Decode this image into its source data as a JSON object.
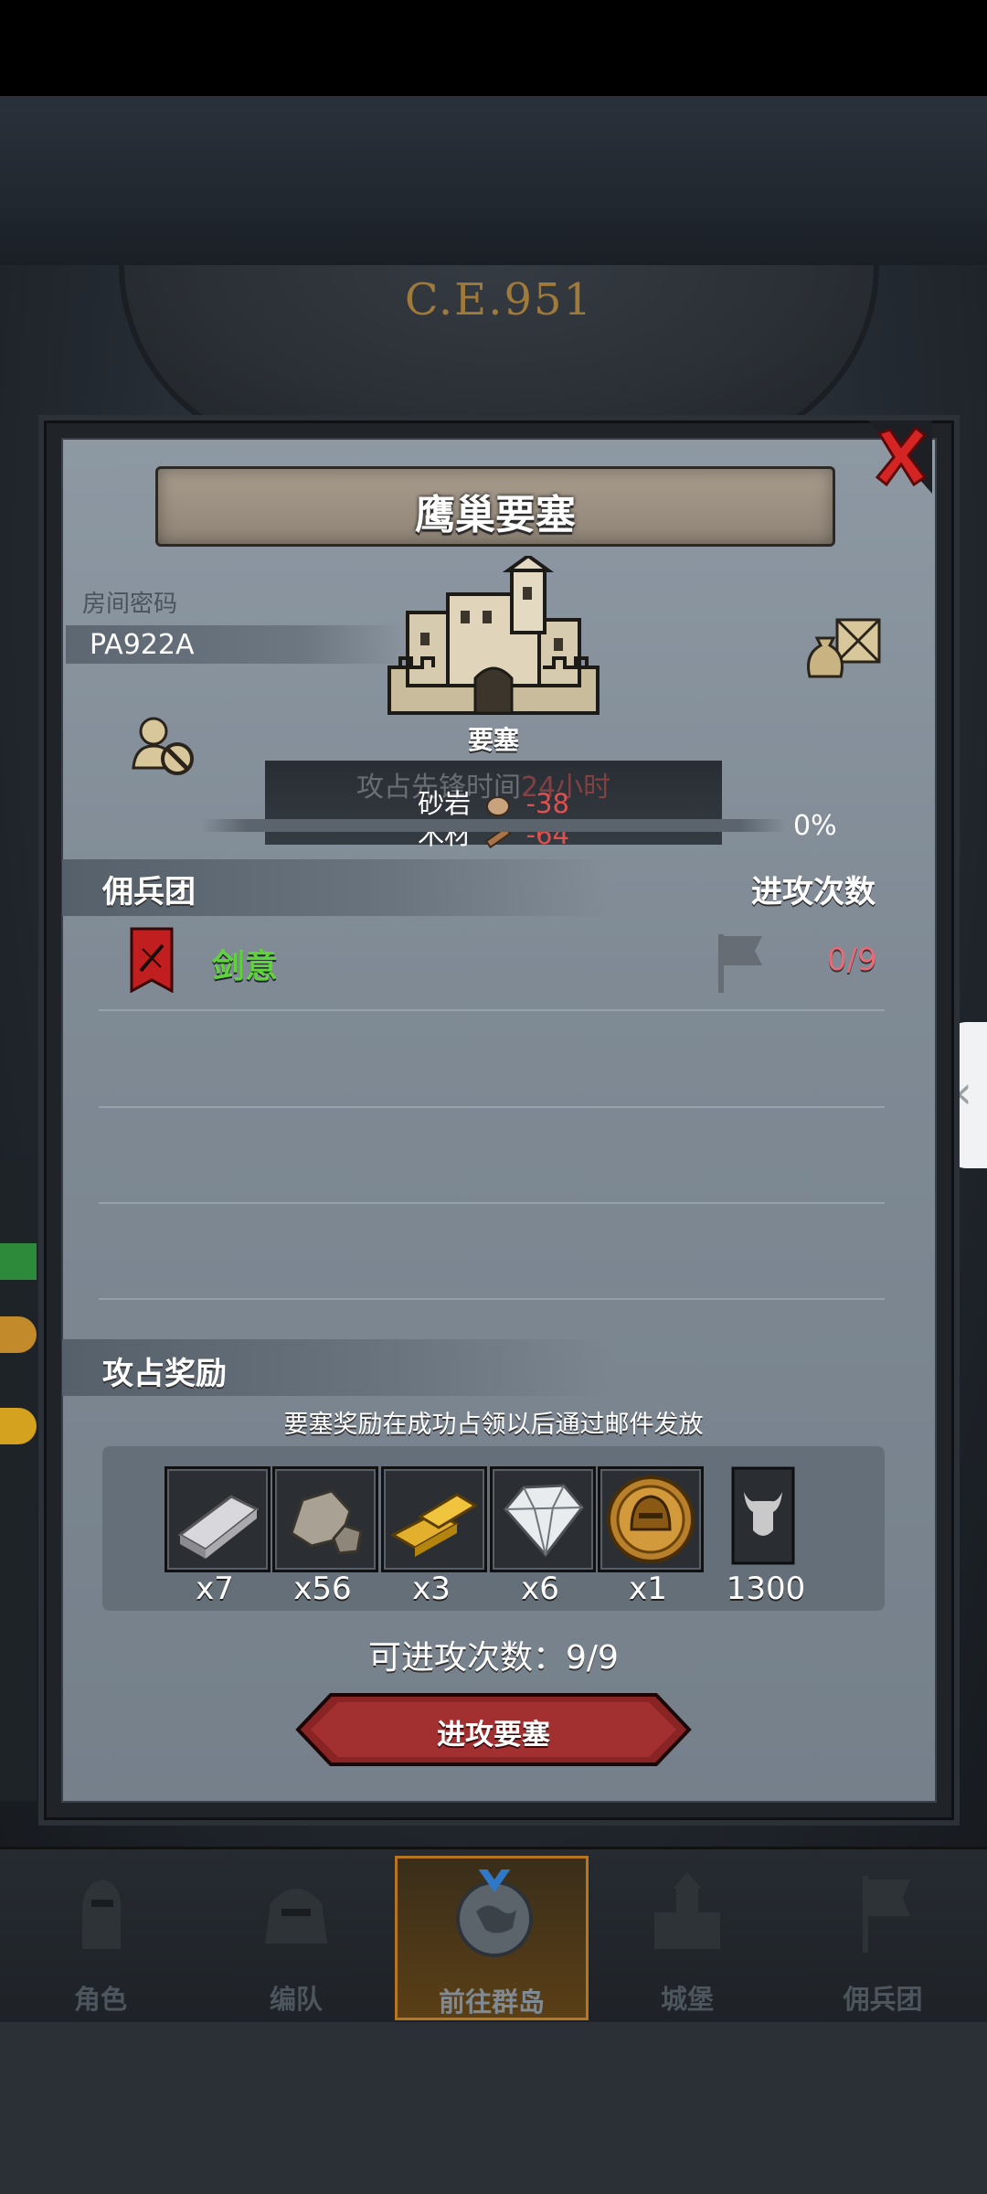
{
  "game": {
    "era_label": "C.E.951"
  },
  "dialog": {
    "title": "鹰巢要塞",
    "room_code_label": "房间密码",
    "room_code": "PA922A",
    "building_label": "要塞",
    "occupy_info_ghost": "攻占先锋时间",
    "occupy_info_ghost_red": "24小时",
    "resources": [
      {
        "name": "砂岩",
        "icon": "stone-icon",
        "value": "-38"
      },
      {
        "name": "木材",
        "icon": "wood-icon",
        "value": "-64"
      }
    ],
    "progress_percent": "0%",
    "progress_value": 0,
    "guild_section_title": "佣兵团",
    "attack_count_title": "进攻次数",
    "guilds": [
      {
        "name": "剑意",
        "attack_count": "0/9"
      }
    ],
    "reward_section_title": "攻占奖励",
    "reward_note": "要塞奖励在成功占领以后通过邮件发放",
    "rewards": [
      {
        "icon": "silver-ingot-icon",
        "count": "x7"
      },
      {
        "icon": "stone-ore-icon",
        "count": "x56"
      },
      {
        "icon": "gold-bars-icon",
        "count": "x3"
      },
      {
        "icon": "diamond-icon",
        "count": "x6"
      },
      {
        "icon": "knight-medal-icon",
        "count": "x1"
      },
      {
        "icon": "bull-banner-icon",
        "count": "1300"
      }
    ],
    "attack_times_label": "可进攻次数：9/9",
    "attack_button_label": "进攻要塞"
  },
  "nav": {
    "items": [
      {
        "label": "角色",
        "icon": "knight-icon"
      },
      {
        "label": "编队",
        "icon": "helmet-icon"
      },
      {
        "label": "前往群岛",
        "icon": "compass-globe-icon",
        "active": true
      },
      {
        "label": "城堡",
        "icon": "castle-icon"
      },
      {
        "label": "佣兵团",
        "icon": "mercenary-icon"
      }
    ]
  },
  "colors": {
    "guild_name": "#5ed43a",
    "attack_count": "#e76a78",
    "negative_resource": "#e0504e",
    "active_nav_border": "#b7751d",
    "era_label": "#a07a3a"
  }
}
